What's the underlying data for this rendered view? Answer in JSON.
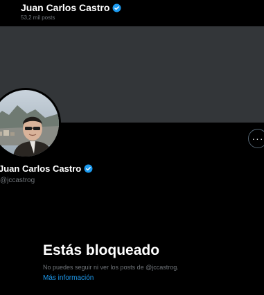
{
  "header": {
    "name": "Juan Carlos Castro",
    "posts_count": "53,2 mil posts"
  },
  "profile": {
    "name": "Juan Carlos Castro",
    "handle": "@jccastrog",
    "more_icon": "more-horizontal-icon",
    "verified_icon": "verified-badge-icon"
  },
  "blocked": {
    "title": "Estás bloqueado",
    "description": "No puedes seguir ni ver los posts de @jccastrog.",
    "link": "Más información"
  },
  "colors": {
    "background": "#000000",
    "banner": "#333639",
    "verified": "#1d9bf0",
    "link": "#1d9bf0",
    "secondary_text": "#71767b"
  }
}
